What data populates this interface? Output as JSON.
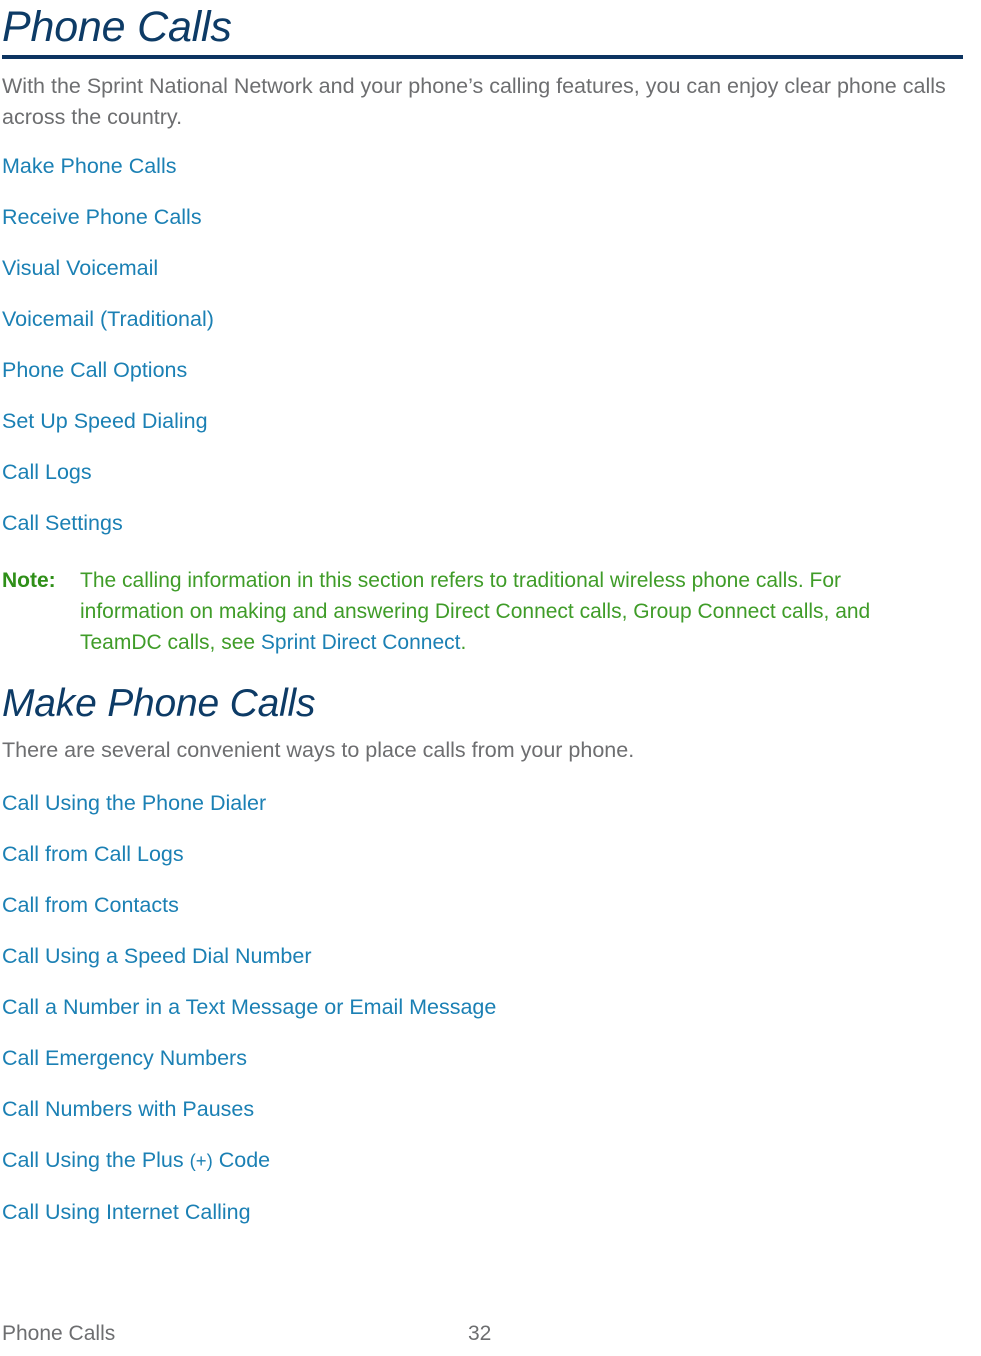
{
  "document": {
    "title": "Phone Calls",
    "intro": "With the Sprint National Network and your phone’s calling features, you can enjoy clear phone calls across the country."
  },
  "toc": {
    "items": [
      {
        "label": "Make Phone Calls"
      },
      {
        "label": "Receive Phone Calls"
      },
      {
        "label": "Visual Voicemail"
      },
      {
        "label": "Voicemail (Traditional)"
      },
      {
        "label": "Phone Call Options"
      },
      {
        "label": "Set Up Speed Dialing"
      },
      {
        "label": "Call Logs"
      },
      {
        "label": "Call Settings"
      }
    ]
  },
  "note": {
    "label": "Note:",
    "text_before_link": "The calling information in this section refers to traditional wireless phone calls. For information on making and answering Direct Connect calls, Group Connect calls, and TeamDC calls, see ",
    "link_label": "Sprint Direct Connect",
    "text_after_link": "."
  },
  "section": {
    "heading": "Make Phone Calls",
    "lead": "There are several convenient ways to place calls from your phone.",
    "links": [
      {
        "label": "Call Using the Phone Dialer"
      },
      {
        "label": "Call from Call Logs"
      },
      {
        "label": "Call from Contacts"
      },
      {
        "label": "Call Using a Speed Dial Number"
      },
      {
        "label": "Call a Number in a Text Message or Email Message"
      },
      {
        "label": "Call Emergency Numbers"
      },
      {
        "label": "Call Numbers with Pauses"
      },
      {
        "label": "Call Using the Plus ",
        "small": "(+)",
        "label_tail": " Code"
      },
      {
        "label": "Call Using Internet Calling"
      }
    ]
  },
  "footer": {
    "section_name": "Phone Calls",
    "page_number": "32"
  },
  "colors": {
    "heading_navy": "#0d3b66",
    "rule_navy": "#0d3461",
    "link_blue": "#1b80b4",
    "body_gray": "#6d6e70",
    "note_green": "#3f9c28",
    "note_label_green": "#2f8f18"
  }
}
